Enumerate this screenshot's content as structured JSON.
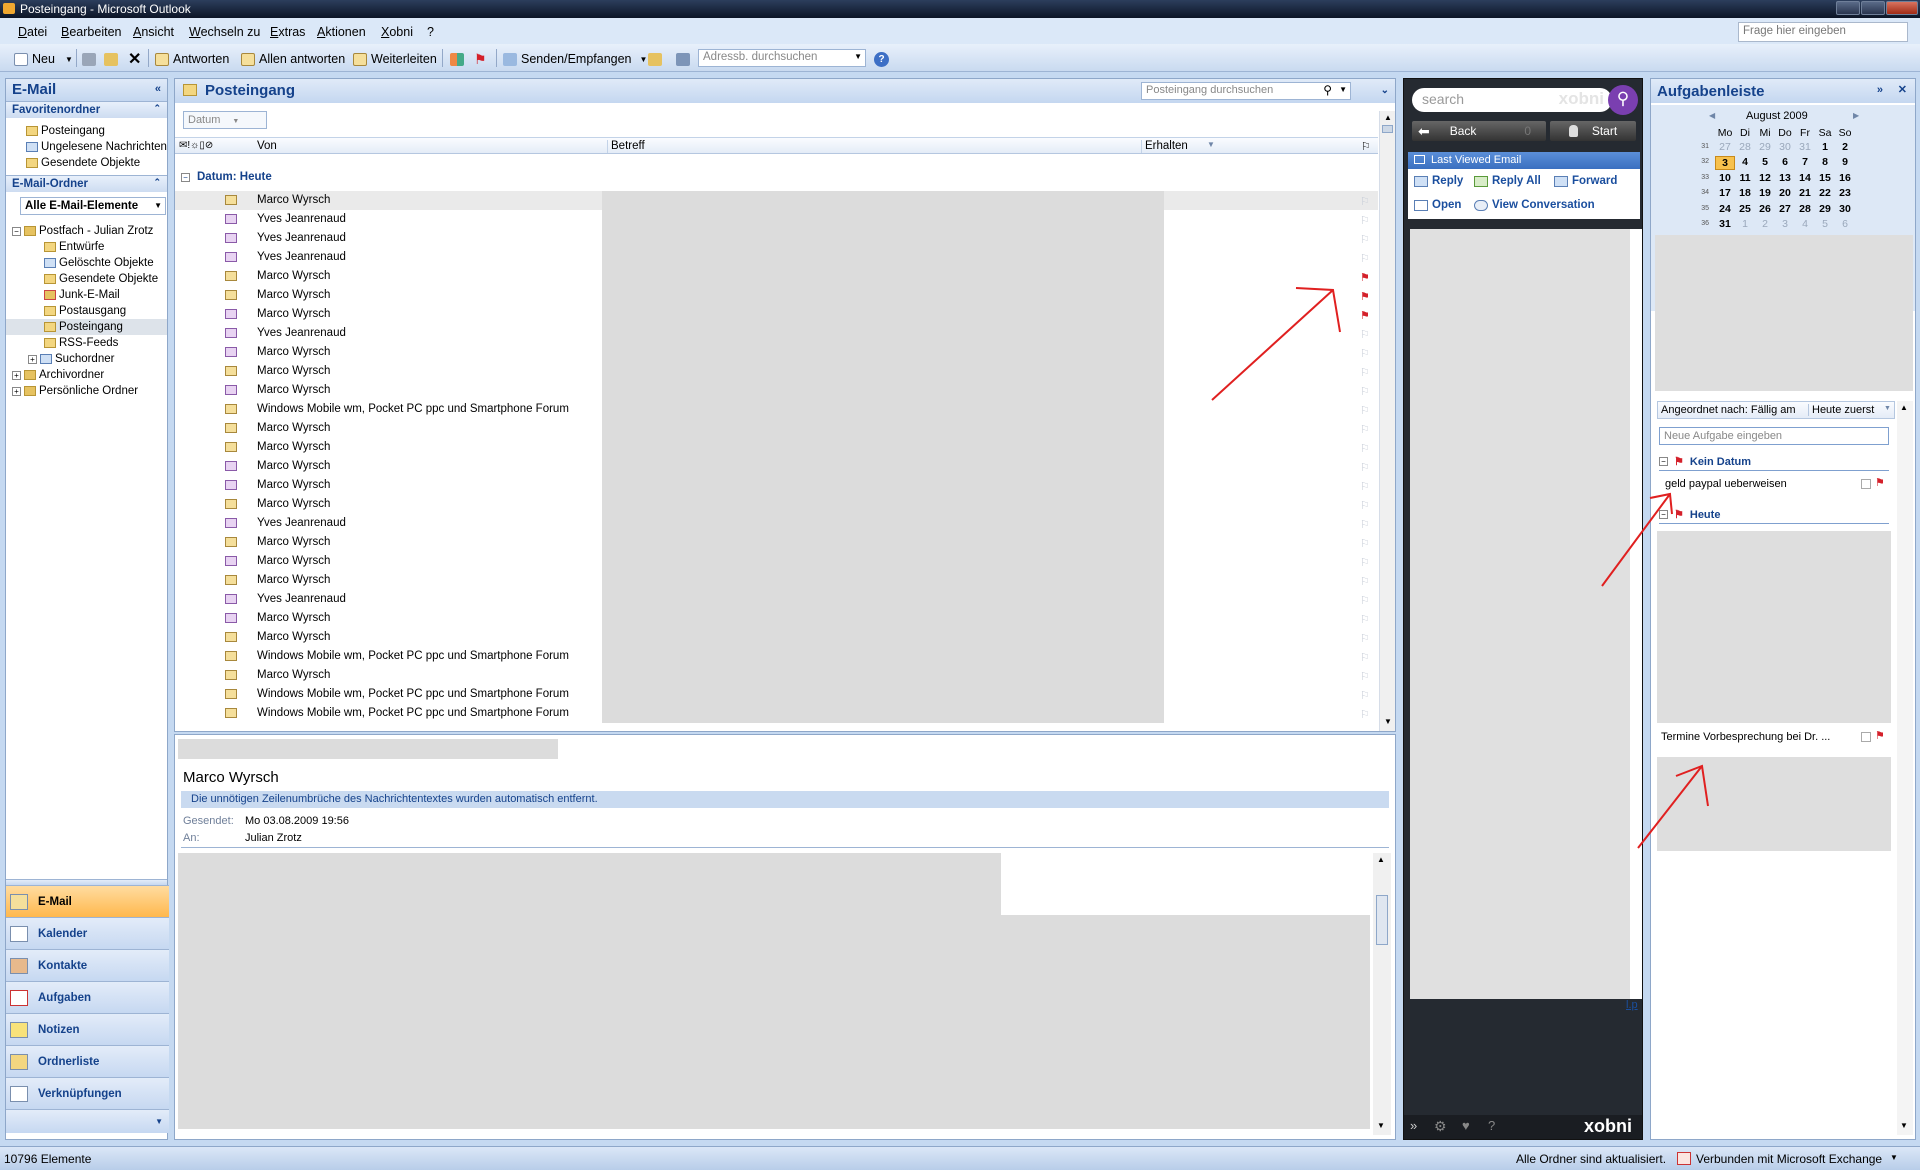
{
  "window": {
    "title": "Posteingang - Microsoft Outlook"
  },
  "menu": {
    "items": [
      "Datei",
      "Bearbeiten",
      "Ansicht",
      "Wechseln zu",
      "Extras",
      "Aktionen",
      "Xobni",
      "?"
    ],
    "help_placeholder": "Frage hier eingeben"
  },
  "toolbar": {
    "new": "Neu",
    "reply": "Antworten",
    "reply_all": "Allen antworten",
    "forward": "Weiterleiten",
    "send_receive": "Senden/Empfangen",
    "address_placeholder": "Adressb. durchsuchen"
  },
  "nav": {
    "title": "E-Mail",
    "favorites_header": "Favoritenordner",
    "favorites": [
      "Posteingang",
      "Ungelesene Nachrichten",
      "Gesendete Objekte"
    ],
    "mail_header": "E-Mail-Ordner",
    "view_select": "Alle E-Mail-Elemente",
    "mailbox": "Postfach - Julian Zrotz",
    "folders": [
      "Entwürfe",
      "Gelöschte Objekte",
      "Gesendete Objekte",
      "Junk-E-Mail",
      "Postausgang",
      "Posteingang",
      "RSS-Feeds",
      "Suchordner"
    ],
    "archive": "Archivordner",
    "personal": "Persönliche Ordner",
    "buttons": [
      "E-Mail",
      "Kalender",
      "Kontakte",
      "Aufgaben",
      "Notizen",
      "Ordnerliste",
      "Verknüpfungen"
    ]
  },
  "inbox": {
    "title": "Posteingang",
    "search_placeholder": "Posteingang durchsuchen",
    "arrange": "Datum",
    "col_from": "Von",
    "col_subject": "Betreff",
    "col_received": "Erhalten",
    "group": "Datum: Heute",
    "rows": [
      {
        "from": "Marco Wyrsch",
        "unread": false,
        "flag": false
      },
      {
        "from": "Yves Jeanrenaud",
        "unread": true,
        "flag": false
      },
      {
        "from": "Yves Jeanrenaud",
        "unread": true,
        "flag": false
      },
      {
        "from": "Yves Jeanrenaud",
        "unread": true,
        "flag": false
      },
      {
        "from": "Marco Wyrsch",
        "unread": false,
        "flag": true
      },
      {
        "from": "Marco Wyrsch",
        "unread": false,
        "flag": true
      },
      {
        "from": "Marco Wyrsch",
        "unread": true,
        "flag": true
      },
      {
        "from": "Yves Jeanrenaud",
        "unread": true,
        "flag": false
      },
      {
        "from": "Marco Wyrsch",
        "unread": true,
        "flag": false
      },
      {
        "from": "Marco Wyrsch",
        "unread": false,
        "flag": false
      },
      {
        "from": "Marco Wyrsch",
        "unread": true,
        "flag": false
      },
      {
        "from": "Windows Mobile wm, Pocket PC ppc und Smartphone Forum",
        "unread": false,
        "flag": false
      },
      {
        "from": "Marco Wyrsch",
        "unread": false,
        "flag": false
      },
      {
        "from": "Marco Wyrsch",
        "unread": false,
        "flag": false
      },
      {
        "from": "Marco Wyrsch",
        "unread": true,
        "flag": false
      },
      {
        "from": "Marco Wyrsch",
        "unread": true,
        "flag": false
      },
      {
        "from": "Marco Wyrsch",
        "unread": false,
        "flag": false
      },
      {
        "from": "Yves Jeanrenaud",
        "unread": true,
        "flag": false
      },
      {
        "from": "Marco Wyrsch",
        "unread": false,
        "flag": false
      },
      {
        "from": "Marco Wyrsch",
        "unread": true,
        "flag": false
      },
      {
        "from": "Marco Wyrsch",
        "unread": false,
        "flag": false
      },
      {
        "from": "Yves Jeanrenaud",
        "unread": true,
        "flag": false
      },
      {
        "from": "Marco Wyrsch",
        "unread": true,
        "flag": false
      },
      {
        "from": "Marco Wyrsch",
        "unread": false,
        "flag": false
      },
      {
        "from": "Windows Mobile wm, Pocket PC ppc und Smartphone Forum",
        "unread": false,
        "flag": false
      },
      {
        "from": "Marco Wyrsch",
        "unread": false,
        "flag": false
      },
      {
        "from": "Windows Mobile wm, Pocket PC ppc und Smartphone Forum",
        "unread": false,
        "flag": false
      },
      {
        "from": "Windows Mobile wm, Pocket PC ppc und Smartphone Forum",
        "unread": false,
        "flag": false
      }
    ]
  },
  "reading": {
    "sender": "Marco Wyrsch",
    "info": "Die unnötigen Zeilenumbrüche des Nachrichtentextes wurden automatisch entfernt.",
    "sent_label": "Gesendet:",
    "sent_value": "Mo 03.08.2009 19:56",
    "to_label": "An:",
    "to_value": "Julian Zrotz"
  },
  "xobni": {
    "search_placeholder": "search",
    "logo": "xobni",
    "back": "Back",
    "count": "0",
    "start": "Start",
    "section": "Last Viewed Email",
    "actions": [
      "Reply",
      "Reply All",
      "Forward",
      "Open",
      "View Conversation"
    ],
    "link_fragment": "l.p"
  },
  "tasks": {
    "title": "Aufgabenleiste",
    "month": "August 2009",
    "weekdays": [
      "Mo",
      "Di",
      "Mi",
      "Do",
      "Fr",
      "Sa",
      "So"
    ],
    "weeks": [
      {
        "wk": "31",
        "days": [
          "27",
          "28",
          "29",
          "30",
          "31",
          "1",
          "2"
        ]
      },
      {
        "wk": "32",
        "days": [
          "3",
          "4",
          "5",
          "6",
          "7",
          "8",
          "9"
        ]
      },
      {
        "wk": "33",
        "days": [
          "10",
          "11",
          "12",
          "13",
          "14",
          "15",
          "16"
        ]
      },
      {
        "wk": "34",
        "days": [
          "17",
          "18",
          "19",
          "20",
          "21",
          "22",
          "23"
        ]
      },
      {
        "wk": "35",
        "days": [
          "24",
          "25",
          "26",
          "27",
          "28",
          "29",
          "30"
        ]
      },
      {
        "wk": "36",
        "days": [
          "31",
          "1",
          "2",
          "3",
          "4",
          "5",
          "6"
        ]
      }
    ],
    "today": "3",
    "sort_label": "Angeordnet nach: Fällig am",
    "sort_order": "Heute zuerst",
    "new_task_placeholder": "Neue Aufgabe eingeben",
    "group_nodate": "Kein Datum",
    "task1": "geld paypal ueberweisen",
    "group_today": "Heute",
    "task2": "Termine Vorbesprechung bei Dr. ..."
  },
  "status": {
    "count": "10796 Elemente",
    "sync": "Alle Ordner sind aktualisiert.",
    "exchange": "Verbunden mit Microsoft Exchange"
  },
  "colors": {
    "accent": "#15428b",
    "flag": "#d4202a",
    "annotation": "#e02020",
    "active_nav": "#ffb84d"
  }
}
